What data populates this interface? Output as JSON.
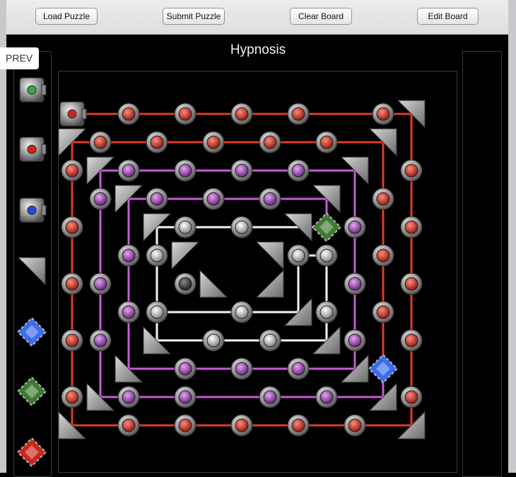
{
  "toolbar": {
    "load_label": "Load Puzzle",
    "submit_label": "Submit Puzzle",
    "clear_label": "Clear Board",
    "edit_label": "Edit Board"
  },
  "prev_label": "PREV",
  "puzzle_title": "Hypnosis",
  "colors": {
    "red_beam": "#e03a28",
    "purple_beam": "#c65ad6",
    "white_beam": "#f4f4f4",
    "red_node": "#c8281c",
    "purple_node": "#a23fbe",
    "white_node": "#d8d8d8",
    "dark_node": "#3a3a3a",
    "blue_crystal": "#3a6cf0",
    "green_crystal": "#3f7a34"
  },
  "palette": [
    {
      "piece": "green-emitter-icon"
    },
    {
      "piece": "red-emitter-icon"
    },
    {
      "piece": "blue-emitter-icon"
    },
    {
      "piece": "mirror-icon"
    },
    {
      "piece": "blue-crystal-icon"
    },
    {
      "piece": "green-crystal-icon"
    },
    {
      "piece": "red-crystal-icon"
    }
  ]
}
